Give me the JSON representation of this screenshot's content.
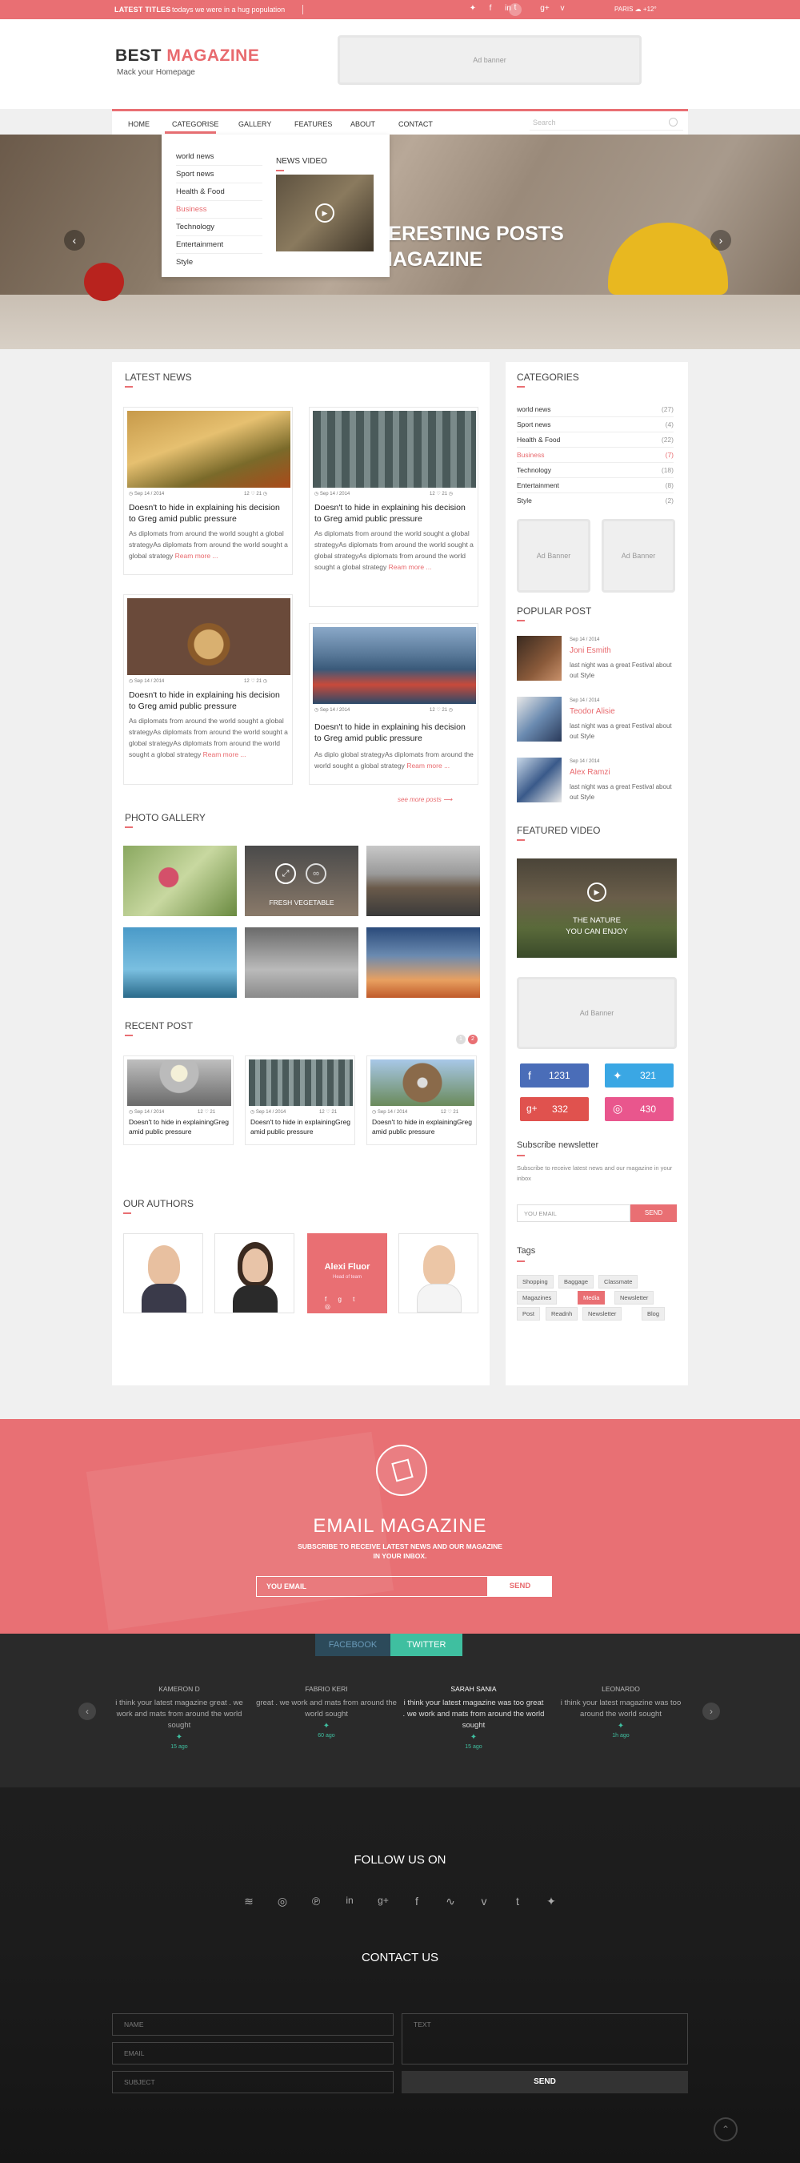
{
  "topbar": {
    "latest_label": "LATEST TITLES",
    "ticker": "todays we were in a hug population",
    "social_icons": [
      "twitter-icon",
      "facebook-icon",
      "linkedin-icon",
      "tumblr-icon",
      "google-plus-icon",
      "vimeo-icon"
    ],
    "weather_city": "PARIS",
    "weather_temp": "+12°"
  },
  "header": {
    "logo_a": "BEST ",
    "logo_b": "MAGAZINE",
    "tagline": "Mack your Homepage",
    "ad": "Ad banner"
  },
  "nav": {
    "items": [
      "HOME",
      "CATEGORISE",
      "GALLERY",
      "FEATURES",
      "ABOUT",
      "CONTACT"
    ],
    "search_placeholder": "Search"
  },
  "dropdown": {
    "items": [
      "world news",
      "Sport  news",
      "Health & Food",
      "Business",
      "Technology",
      "Entertainment",
      "Style"
    ],
    "active": "Business",
    "video_title": "NEWS VIDEO"
  },
  "hero": {
    "line1": "TERESTING POSTS",
    "line2": "MAGAZINE"
  },
  "latest_news": {
    "title": "LATEST NEWS",
    "cards": [
      {
        "date": "Sep 14 / 2014",
        "comments": "12",
        "likes": "21",
        "title": "Doesn't to hide in explaining his decision to Greg amid public pressure",
        "body": "As diplomats from around the world sought a global strategyAs diplomats from around the world sought a global  strategy",
        "more": "Ream more ..."
      },
      {
        "date": "Sep 14 / 2014",
        "comments": "12",
        "likes": "21",
        "title": "Doesn't to hide in explaining his decision to Greg amid public pressure",
        "body": "As diplomats from around the world sought a global strategyAs diplomats from around the world sought a global strategyAs diplomats from around the world sought a global strategy",
        "more": "Ream more ..."
      },
      {
        "date": "Sep 14 / 2014",
        "comments": "12",
        "likes": "21",
        "title": "Doesn't to hide in explaining his decision to Greg amid public pressure",
        "body": "As diplomats from around the world sought a global strategyAs diplomats from around the world sought a global strategyAs diplomats from around the world sought a global strategy",
        "more": "Ream more ..."
      },
      {
        "date": "Sep 14 / 2014",
        "comments": "12",
        "likes": "21",
        "title": "Doesn't to hide in explaining his decision to Greg amid public pressure",
        "body": "As diplo global strategyAs diplomats from around the world sought a global strategy",
        "more": "Ream more ..."
      }
    ],
    "see_more": "see more posts"
  },
  "gallery": {
    "title": "PHOTO GALLERY",
    "caption": "FRESH VEGETABLE"
  },
  "recent": {
    "title": "RECENT POST",
    "cards": [
      {
        "date": "Sep 14 / 2014",
        "comments": "12",
        "likes": "21",
        "title": "Doesn't to hide in explainingGreg amid public pressure"
      },
      {
        "date": "Sep 14 / 2014",
        "comments": "12",
        "likes": "21",
        "title": "Doesn't to hide in explainingGreg amid public pressure"
      },
      {
        "date": "Sep 14 / 2014",
        "comments": "12",
        "likes": "21",
        "title": "Doesn't to hide in explainingGreg amid public pressure"
      }
    ],
    "pager": [
      "1",
      "2"
    ]
  },
  "authors": {
    "title": "OUR AUTHORS",
    "featured_name": "Alexi Fluor",
    "featured_role": "Head of team"
  },
  "sidebar": {
    "categories_title": "CATEGORIES",
    "categories": [
      {
        "name": "world news",
        "count": "(27)"
      },
      {
        "name": "Sport  news",
        "count": "(4)"
      },
      {
        "name": "Health & Food",
        "count": "(22)"
      },
      {
        "name": "Business",
        "count": "(7)"
      },
      {
        "name": "Technology",
        "count": "(18)"
      },
      {
        "name": "Entertainment",
        "count": "(8)"
      },
      {
        "name": "Style",
        "count": "(2)"
      }
    ],
    "ad": "Ad Banner",
    "popular_title": "POPULAR POST",
    "popular": [
      {
        "date": "Sep 14 / 2014",
        "name": "Joni Esmith",
        "text": "last night was a great Festival about out Style"
      },
      {
        "date": "Sep 14 / 2014",
        "name": "Teodor Alisie",
        "text": "last night was a great Festival about out Style"
      },
      {
        "date": "Sep 14 / 2014",
        "name": "Alex Ramzi",
        "text": "last night was a great Festival about out Style"
      }
    ],
    "video_title": "FEATURED VIDEO",
    "video_line1": "THE NATURE",
    "video_line2": "YOU CAN ENJOY",
    "ad2": "Ad Banner",
    "social": [
      {
        "icon": "facebook-icon",
        "count": "1231"
      },
      {
        "icon": "twitter-icon",
        "count": "321"
      },
      {
        "icon": "google-plus-icon",
        "count": "332"
      },
      {
        "icon": "dribbble-icon",
        "count": "430"
      }
    ],
    "subscribe_title": "Subscribe newsletter",
    "subscribe_text": "Subscribe to receive latest  news and our magazine in your inbox",
    "email_placeholder": "YOU EMAIL",
    "send": "SEND",
    "tags_title": "Tags",
    "tags": [
      "Shopping",
      "Baggage",
      "Classmate",
      "Magazines",
      "Media",
      "Newsletter",
      "Post",
      "Readnh",
      "Newsletter",
      "Blog"
    ]
  },
  "email": {
    "title": "EMAIL MAGAZINE",
    "sub1": "SUBSCRIBE TO RECEIVE LATEST  NEWS AND OUR MAGAZINE",
    "sub2": "IN YOUR INBOX.",
    "placeholder": "YOU EMAIL",
    "send": "SEND"
  },
  "testimonials": {
    "tabs": [
      "FACEBOOK",
      "TWITTER"
    ],
    "items": [
      {
        "name": "KAMERON D",
        "text": "i think your latest magazine great . we work and mats from around the world sought",
        "time": "15 ago"
      },
      {
        "name": "FABRIO KERI",
        "text": "great . we work and mats from around the world sought",
        "time": "60 ago"
      },
      {
        "name": "SARAH SANIA",
        "text": "i think your latest magazine was too great . we work and mats from around the world sought",
        "time": "15 ago"
      },
      {
        "name": "LEONARDO",
        "text": "i think your latest magazine was too around the world sought",
        "time": "1h ago"
      }
    ]
  },
  "footer": {
    "follow_title": "FOLLOW US ON",
    "icons": [
      "rss-icon",
      "dribbble-icon",
      "pinterest-icon",
      "linkedin-icon",
      "google-plus-icon",
      "facebook-icon",
      "stumbleupon-icon",
      "vimeo-icon",
      "tumblr-icon",
      "twitter-icon"
    ],
    "contact_title": "CONTACT US",
    "name": "NAME",
    "email": "EMAIL",
    "subject": "SUBJECT",
    "text": "TEXT",
    "send": "SEND"
  },
  "colors": {
    "accent": "#e96f73",
    "dark": "#2a2a2a",
    "facebook": "#4a6db8",
    "twitter": "#3aa7e4",
    "googleplus": "#e0524e",
    "dribbble": "#e9568d",
    "teal": "#3fbfa0"
  }
}
